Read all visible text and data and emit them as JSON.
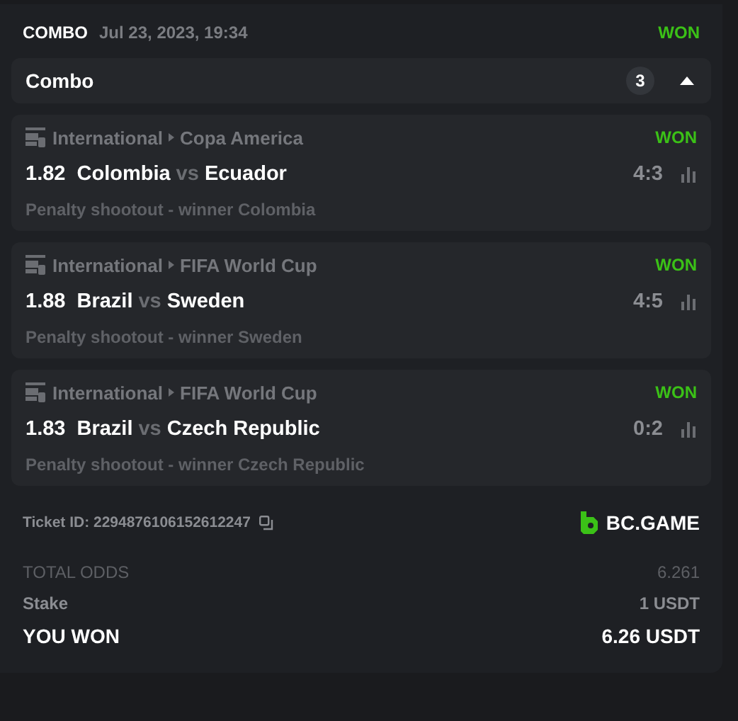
{
  "header": {
    "type": "COMBO",
    "date": "Jul 23, 2023, 19:34",
    "status": "WON"
  },
  "combo": {
    "title": "Combo",
    "count": "3",
    "expanded": true
  },
  "legs": [
    {
      "category": "International",
      "league": "Copa America",
      "status": "WON",
      "odds": "1.82",
      "home": "Colombia",
      "vs": "vs",
      "away": "Ecuador",
      "score": "4:3",
      "market": "Penalty shootout - winner Colombia"
    },
    {
      "category": "International",
      "league": "FIFA World Cup",
      "status": "WON",
      "odds": "1.88",
      "home": "Brazil",
      "vs": "vs",
      "away": "Sweden",
      "score": "4:5",
      "market": "Penalty shootout - winner Sweden"
    },
    {
      "category": "International",
      "league": "FIFA World Cup",
      "status": "WON",
      "odds": "1.83",
      "home": "Brazil",
      "vs": "vs",
      "away": "Czech Republic",
      "score": "0:2",
      "market": "Penalty shootout - winner Czech Republic"
    }
  ],
  "ticket": {
    "label": "Ticket ID: 2294876106152612247",
    "brand": "BC.GAME"
  },
  "summary": [
    {
      "kind": "muted",
      "label": "TOTAL ODDS",
      "value": "6.261"
    },
    {
      "kind": "normal",
      "label": "Stake",
      "value": "1 USDT"
    },
    {
      "kind": "total",
      "label": "YOU WON",
      "value": "6.26 USDT"
    }
  ]
}
